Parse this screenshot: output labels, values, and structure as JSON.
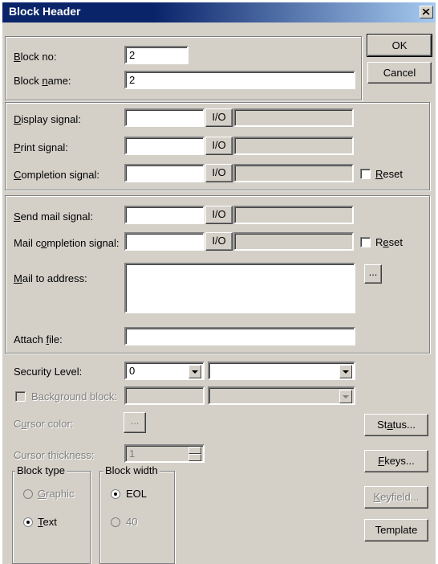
{
  "window": {
    "title": "Block Header"
  },
  "buttons": {
    "ok": "OK",
    "cancel": "Cancel",
    "status": "Status...",
    "fkeys": "Fkeys...",
    "keyfield": "Keyfield...",
    "template": "Template",
    "browse": "...",
    "io": "I/O"
  },
  "block": {
    "no_label": "Block no:",
    "no_value": "2",
    "name_label": "Block name:",
    "name_value": "2"
  },
  "signals": {
    "display": "Display signal:",
    "print": "Print signal:",
    "completion": "Completion signal:",
    "reset": "Reset"
  },
  "mail": {
    "send": "Send mail signal:",
    "completion": "Mail completion signal:",
    "reset": "Reset",
    "address": "Mail to address:",
    "attach": "Attach file:"
  },
  "security": {
    "label": "Security Level:",
    "value": "0"
  },
  "background": {
    "label": "Background block:"
  },
  "cursor": {
    "color_label": "Cursor color:",
    "thickness_label": "Cursor thickness:",
    "thickness_value": "1"
  },
  "block_type": {
    "title": "Block type",
    "graphic": "Graphic",
    "text": "Text"
  },
  "block_width": {
    "title": "Block width",
    "eol": "EOL",
    "forty": "40"
  }
}
